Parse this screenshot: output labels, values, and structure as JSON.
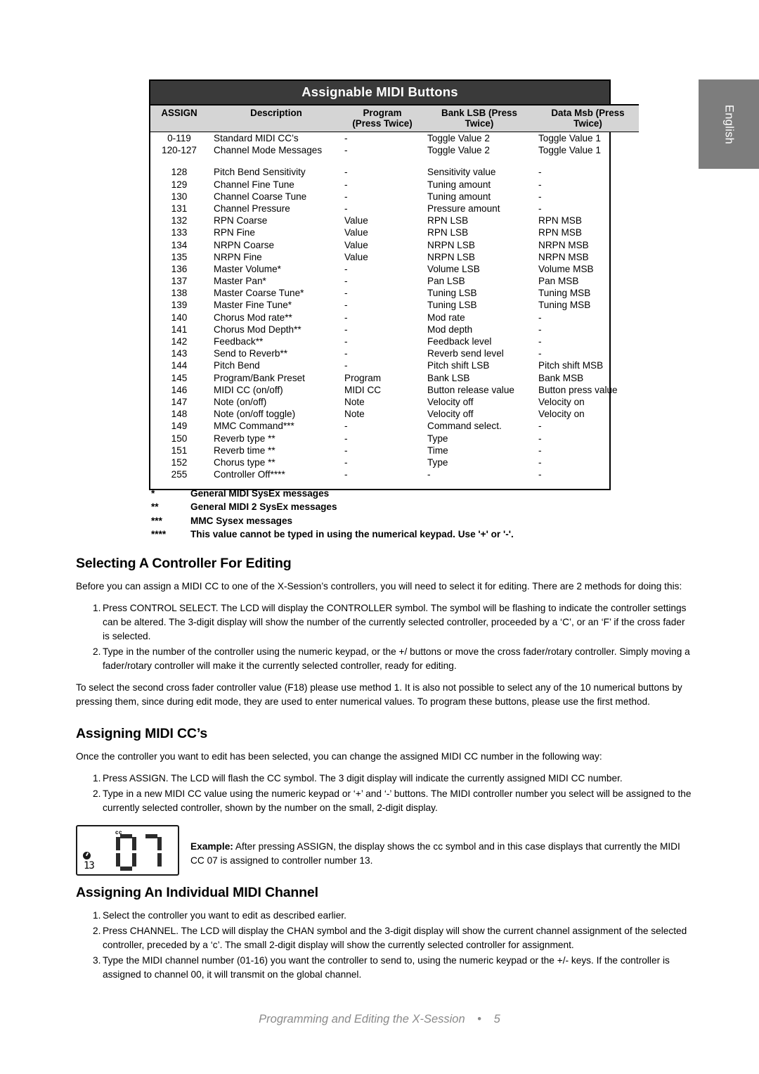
{
  "language_tab": {
    "label": "English"
  },
  "table": {
    "title": "Assignable MIDI Buttons",
    "headers": {
      "assign": "ASSIGN",
      "description": "Description",
      "program_line1": "Program",
      "program_line2": "(Press Twice)",
      "bank_lsb_line1": "Bank LSB (Press",
      "bank_lsb_line2": "Twice)",
      "data_msb_line1": "Data  Msb (Press",
      "data_msb_line2": "Twice)"
    },
    "group1": [
      {
        "assign": "0-119",
        "description": "Standard MIDI CC’s",
        "program": "-",
        "bank_lsb": "Toggle Value 2",
        "data_msb": "Toggle Value 1"
      },
      {
        "assign": "120-127",
        "description": "Channel Mode Messages",
        "program": "-",
        "bank_lsb": "Toggle Value 2",
        "data_msb": "Toggle Value 1"
      }
    ],
    "group2": [
      {
        "assign": "128",
        "description": "Pitch Bend Sensitivity",
        "program": "-",
        "bank_lsb": "Sensitivity  value",
        "data_msb": "-"
      },
      {
        "assign": "129",
        "description": "Channel Fine Tune",
        "program": "-",
        "bank_lsb": "Tuning amount",
        "data_msb": "-"
      },
      {
        "assign": "130",
        "description": "Channel Coarse Tune",
        "program": "-",
        "bank_lsb": "Tuning amount",
        "data_msb": "-"
      },
      {
        "assign": "131",
        "description": "Channel Pressure",
        "program": "-",
        "bank_lsb": "Pressure amount",
        "data_msb": "-"
      },
      {
        "assign": "132",
        "description": "RPN Coarse",
        "program": "Value",
        "bank_lsb": "RPN LSB",
        "data_msb": "RPN MSB"
      },
      {
        "assign": "133",
        "description": "RPN Fine",
        "program": "Value",
        "bank_lsb": "RPN LSB",
        "data_msb": "RPN MSB"
      },
      {
        "assign": "134",
        "description": "NRPN Coarse",
        "program": "Value",
        "bank_lsb": "NRPN LSB",
        "data_msb": "NRPN MSB"
      },
      {
        "assign": "135",
        "description": "NRPN Fine",
        "program": "Value",
        "bank_lsb": "NRPN LSB",
        "data_msb": "NRPN MSB"
      },
      {
        "assign": "136",
        "description": "Master Volume*",
        "program": "-",
        "bank_lsb": "Volume LSB",
        "data_msb": "Volume MSB"
      },
      {
        "assign": "137",
        "description": "Master Pan*",
        "program": "-",
        "bank_lsb": "Pan LSB",
        "data_msb": "Pan MSB"
      },
      {
        "assign": "138",
        "description": "Master Coarse Tune*",
        "program": "-",
        "bank_lsb": "Tuning LSB",
        "data_msb": "Tuning MSB"
      },
      {
        "assign": "139",
        "description": "Master Fine Tune*",
        "program": "-",
        "bank_lsb": "Tuning LSB",
        "data_msb": "Tuning MSB"
      },
      {
        "assign": "140",
        "description": "Chorus Mod rate**",
        "program": "-",
        "bank_lsb": "Mod rate",
        "data_msb": "-"
      },
      {
        "assign": "141",
        "description": "Chorus Mod Depth**",
        "program": "-",
        "bank_lsb": "Mod depth",
        "data_msb": "-"
      },
      {
        "assign": "142",
        "description": "Feedback**",
        "program": "-",
        "bank_lsb": "Feedback level",
        "data_msb": "-"
      },
      {
        "assign": "143",
        "description": "Send to Reverb**",
        "program": "-",
        "bank_lsb": "Reverb send level",
        "data_msb": "-"
      },
      {
        "assign": "144",
        "description": "Pitch Bend",
        "program": "-",
        "bank_lsb": "Pitch shift LSB",
        "data_msb": "Pitch shift MSB"
      },
      {
        "assign": "145",
        "description": "Program/Bank Preset",
        "program": "Program",
        "bank_lsb": "Bank LSB",
        "data_msb": "Bank MSB"
      },
      {
        "assign": "146",
        "description": "MIDI CC (on/off)",
        "program": "MIDI CC",
        "bank_lsb": "Button release value",
        "data_msb": "Button press value"
      },
      {
        "assign": "147",
        "description": "Note  (on/off)",
        "program": "Note",
        "bank_lsb": "Velocity off",
        "data_msb": "Velocity on"
      },
      {
        "assign": "148",
        "description": "Note (on/off toggle)",
        "program": "Note",
        "bank_lsb": "Velocity off",
        "data_msb": "Velocity on"
      },
      {
        "assign": "149",
        "description": "MMC Command***",
        "program": "-",
        "bank_lsb": "Command select.",
        "data_msb": "-"
      },
      {
        "assign": "150",
        "description": "Reverb type **",
        "program": "-",
        "bank_lsb": "Type",
        "data_msb": "-"
      },
      {
        "assign": "151",
        "description": "Reverb time **",
        "program": "-",
        "bank_lsb": "Time",
        "data_msb": "-"
      },
      {
        "assign": "152",
        "description": "Chorus type **",
        "program": "-",
        "bank_lsb": "Type",
        "data_msb": "-"
      },
      {
        "assign": "255",
        "description": "Controller Off****",
        "program": "-",
        "bank_lsb": "-",
        "data_msb": "-"
      }
    ]
  },
  "footnotes": [
    {
      "mark": "*",
      "text": "General MIDI SysEx messages"
    },
    {
      "mark": "**",
      "text": "General MIDI 2 SysEx messages"
    },
    {
      "mark": "***",
      "text": "MMC Sysex messages"
    },
    {
      "mark": "****",
      "text": "This value cannot be typed in using the numerical keypad.  Use '+' or '-'."
    }
  ],
  "sections": {
    "selecting": {
      "heading": "Selecting A Controller For Editing",
      "intro": "Before you can assign a MIDI CC to one of the X-Session’s controllers, you will need to select it for editing. There are 2 methods for doing this:",
      "steps": [
        {
          "num": "1.",
          "text": "Press CONTROL SELECT. The LCD will display the CONTROLLER symbol. The symbol will be flashing to indicate the controller settings can be altered. The 3-digit display will show the number of the currently selected controller, proceeded by a ‘C’, or an ‘F’ if the cross fader is selected."
        },
        {
          "num": "2.",
          "text": "Type in the number of the controller using the numeric keypad, or the +/ buttons or move the cross fader/rotary controller. Simply moving a fader/rotary controller will make it the currently selected controller, ready for editing."
        }
      ],
      "outro": "To select the second cross fader controller value (F18) please use method 1. It is also not possible to select any of the 10 numerical buttons by pressing them, since during edit mode, they are used to enter numerical values. To program these buttons, please use the first method."
    },
    "assigning_cc": {
      "heading": "Assigning MIDI CC’s",
      "intro": "Once the controller you want to edit has been selected, you can change the assigned MIDI CC number in the following way:",
      "steps": [
        {
          "num": "1.",
          "text": "Press ASSIGN. The LCD will flash the CC symbol. The 3 digit display will indicate the currently assigned MIDI CC number."
        },
        {
          "num": "2.",
          "text": "Type in a new MIDI CC value using the numeric keypad or ‘+’ and ‘-’ buttons. The MIDI controller number you select will be assigned to the currently selected controller, shown by the number on the small, 2-digit display."
        }
      ]
    },
    "example": {
      "label": "Example:",
      "text": " After pressing ASSIGN, the display shows the cc symbol and in this case displays that currently the MIDI CC 07 is assigned to controller number 13.",
      "lcd": {
        "cc_label": "cc",
        "small_value": "13",
        "digit_1": "0",
        "digit_2": "7"
      }
    },
    "assigning_channel": {
      "heading": "Assigning An Individual MIDI Channel",
      "steps": [
        {
          "num": "1.",
          "text": "Select the controller you want to edit as described earlier."
        },
        {
          "num": "2.",
          "text": "Press CHANNEL. The LCD will display the CHAN symbol and the 3-digit display will show the current channel assignment of the selected controller, preceded by a ‘c’. The small 2-digit display will show the currently selected controller for assignment."
        },
        {
          "num": "3.",
          "text": "Type the MIDI channel number (01-16) you want the controller to send to, using the numeric keypad or the +/- keys.  If the controller is assigned to channel 00, it will transmit on the global channel."
        }
      ]
    }
  },
  "footer": {
    "title": "Programming and Editing the X-Session",
    "separator": "•",
    "page_number": "5"
  },
  "colors": {
    "table_title_bg": "#3a3a3a",
    "table_header_bg": "#d5d5d5",
    "lang_tab_bg": "#7d7d7d",
    "footer_text": "#8a8a8a"
  }
}
